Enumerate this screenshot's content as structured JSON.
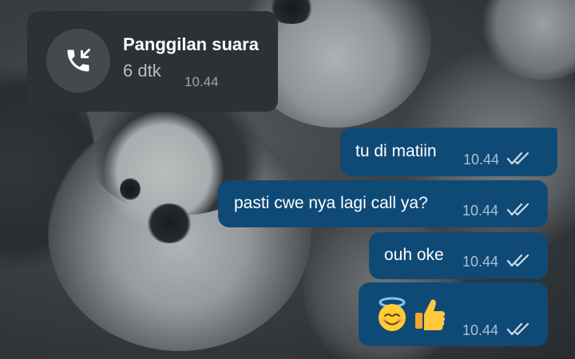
{
  "call": {
    "title": "Panggilan suara",
    "duration": "6 dtk",
    "time": "10.44",
    "icon": "incoming-call-icon"
  },
  "messages": [
    {
      "text": "tu di matiin",
      "time": "10.44",
      "status": "read"
    },
    {
      "text": "pasti cwe nya lagi call ya?",
      "time": "10.44",
      "status": "read"
    },
    {
      "text": "ouh oke",
      "time": "10.44",
      "status": "read"
    },
    {
      "text": "",
      "emoji": [
        "smiling-face-with-halo",
        "thumbs-up"
      ],
      "time": "10.44",
      "status": "read"
    }
  ],
  "colors": {
    "outgoing_bubble": "#0f4a76",
    "call_bubble": "#2d3134",
    "read_ticks": "#d0dbe6"
  }
}
